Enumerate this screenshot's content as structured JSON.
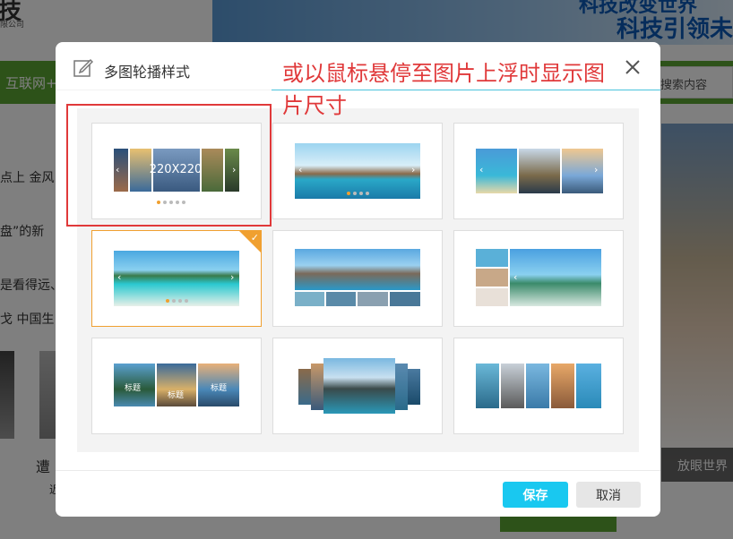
{
  "background": {
    "logo_char": "技",
    "logo_subtitle": "限公司",
    "banner_line1": "科技改变世界",
    "banner_line2": "科技引领未",
    "nav_item": "互联网+",
    "search_placeholder": "搜索内容",
    "news_lines": [
      "点上 金风",
      "盘”的新",
      "是看得远、",
      "戈 中国生"
    ],
    "bottom_text1": "遭",
    "bottom_text2": "近",
    "caption": "放眼世界"
  },
  "modal": {
    "title": "多图轮播样式",
    "close_label": "×",
    "save_label": "保存",
    "cancel_label": "取消",
    "selected_index": 3,
    "first_card_size_label": "220X220",
    "caption_labels": [
      "标题",
      "标题",
      "标题"
    ],
    "arrow_left": "‹",
    "arrow_right": "›",
    "check_mark": "✓"
  },
  "annotation": {
    "text": "或以鼠标悬停至图片上浮时显示图片尺寸",
    "color": "#e0393a"
  },
  "colors": {
    "accent": "#19c8f0",
    "selected_border": "#f0a030",
    "brand_green": "#5aa532"
  }
}
